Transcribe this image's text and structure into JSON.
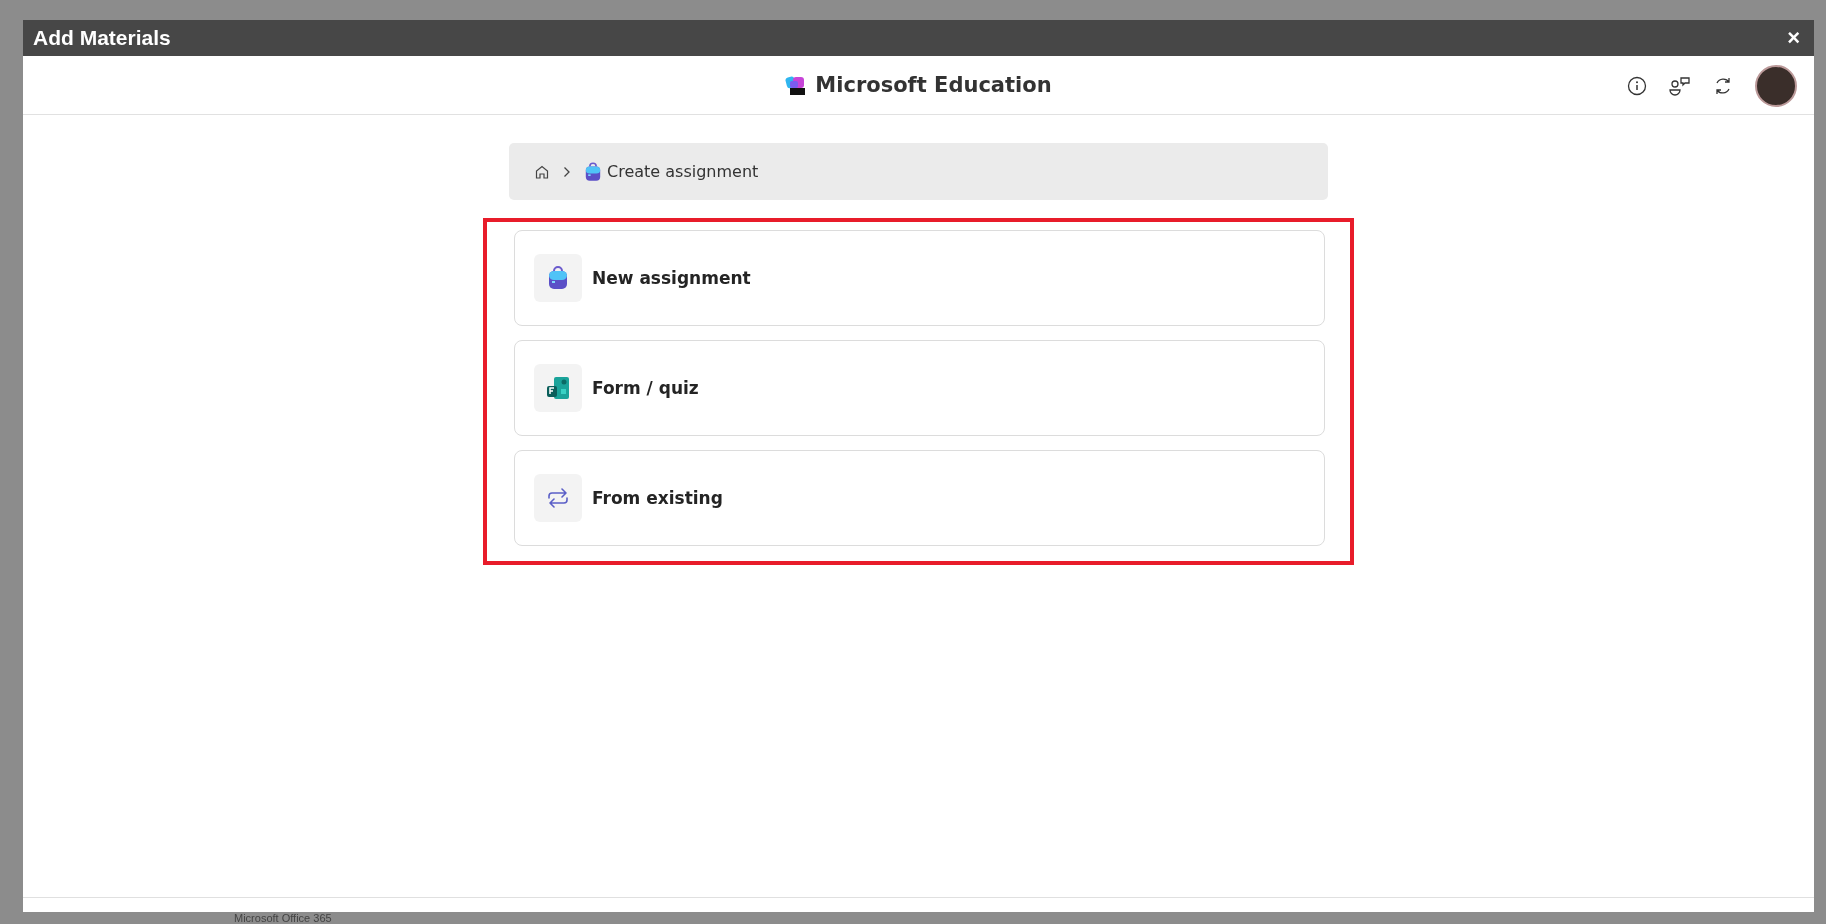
{
  "window": {
    "title": "Add Materials",
    "close": "×"
  },
  "header": {
    "app_name": "Microsoft Education"
  },
  "breadcrumb": {
    "current": "Create assignment"
  },
  "options": [
    {
      "kind": "assignment",
      "label": "New assignment"
    },
    {
      "kind": "form",
      "label": "Form / quiz"
    },
    {
      "kind": "existing",
      "label": "From existing"
    }
  ],
  "background": {
    "taskbar_text": "Microsoft Office 365"
  }
}
